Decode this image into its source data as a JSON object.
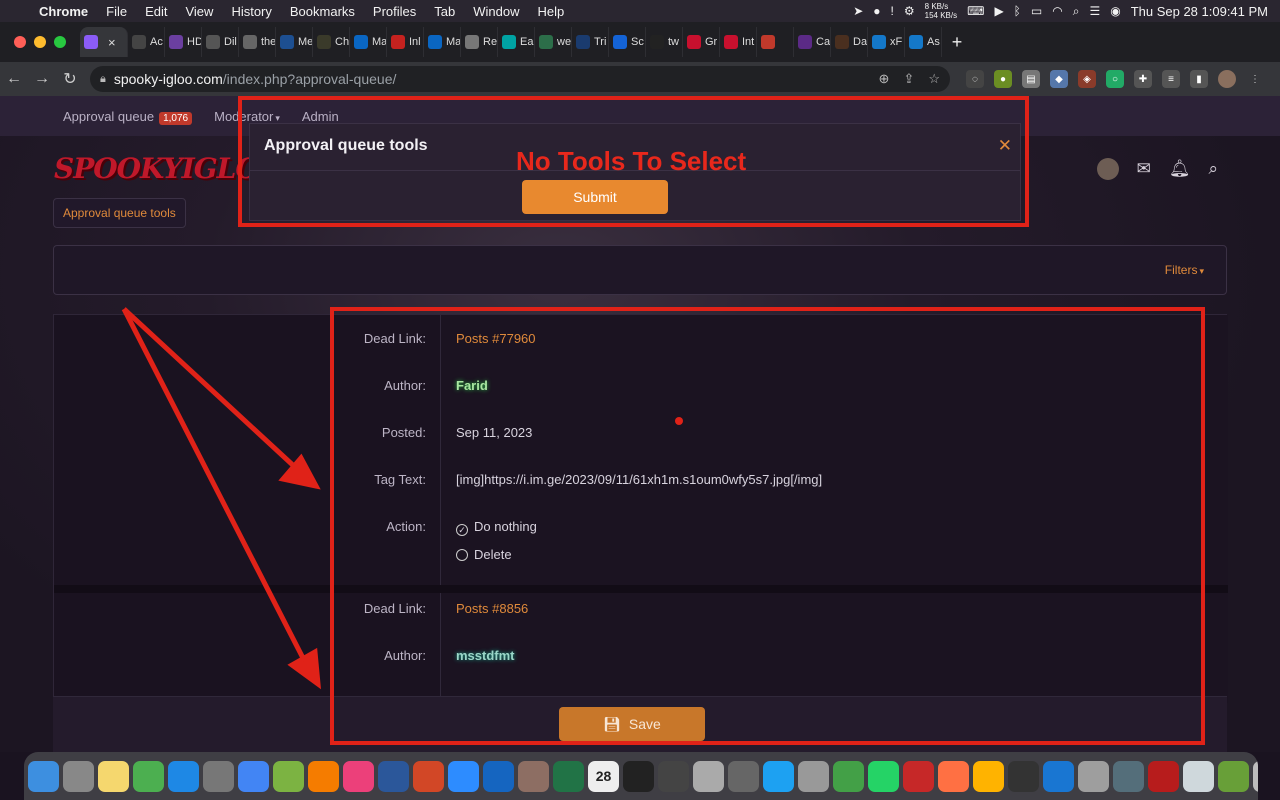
{
  "menubar": {
    "items": [
      "Chrome",
      "File",
      "Edit",
      "View",
      "History",
      "Bookmarks",
      "Profiles",
      "Tab",
      "Window",
      "Help"
    ],
    "net_up": "8 KB/s",
    "net_down": "154 KB/s",
    "clock": "Thu Sep 28  1:09:41 PM"
  },
  "tabs": [
    {
      "label": "",
      "color": "#8b5cf6",
      "icon": "ghost-icon"
    },
    {
      "label": "Ac",
      "color": "#444",
      "icon": "site-icon"
    },
    {
      "label": "HD",
      "color": "#6b3fa0",
      "icon": "site-icon"
    },
    {
      "label": "Dil",
      "color": "#555",
      "icon": "site-icon"
    },
    {
      "label": "the",
      "color": "#666",
      "icon": "globe-icon"
    },
    {
      "label": "Me",
      "color": "#1d4f91",
      "icon": "site-icon"
    },
    {
      "label": "Ch",
      "color": "#3a3a2a",
      "icon": "site-icon"
    },
    {
      "label": "Ma",
      "color": "#0a66c2",
      "icon": "outlook-icon"
    },
    {
      "label": "Inl",
      "color": "#c5221f",
      "icon": "gmail-icon"
    },
    {
      "label": "Ma",
      "color": "#0a66c2",
      "icon": "outlook-icon"
    },
    {
      "label": "Re",
      "color": "#777",
      "icon": "site-icon"
    },
    {
      "label": "Ea",
      "color": "#00a3a3",
      "icon": "site-icon"
    },
    {
      "label": "we",
      "color": "#2c6e49",
      "icon": "site-icon"
    },
    {
      "label": "Tri",
      "color": "#1a3b6e",
      "icon": "site-icon"
    },
    {
      "label": "Sc",
      "color": "#1463d6",
      "icon": "site-icon"
    },
    {
      "label": "tw",
      "color": "#222",
      "icon": "x-icon"
    },
    {
      "label": "Gr",
      "color": "#c8102e",
      "icon": "maple-icon"
    },
    {
      "label": "Int",
      "color": "#c8102e",
      "icon": "maple-icon"
    },
    {
      "label": "",
      "color": "#c0392b",
      "icon": "youtube-icon"
    },
    {
      "label": "Ca",
      "color": "#5b2a86",
      "icon": "site-icon"
    },
    {
      "label": "Da",
      "color": "#4a2f1f",
      "icon": "site-icon"
    },
    {
      "label": "xF",
      "color": "#1478c9",
      "icon": "xf-icon"
    },
    {
      "label": "As",
      "color": "#1478c9",
      "icon": "xf-icon"
    }
  ],
  "address": {
    "host": "spooky-igloo.com",
    "path": "/index.php?approval-queue/"
  },
  "staffbar": {
    "approval_label": "Approval queue",
    "approval_count": "1,076",
    "moderator_label": "Moderator",
    "admin_label": "Admin"
  },
  "logo_text": "SPOOKYIGLOO",
  "crumb_tab": "Approval queue tools",
  "filters_label": "Filters",
  "entries": [
    {
      "dead_link_label": "Dead Link:",
      "dead_link_value": "Posts #77960",
      "author_label": "Author:",
      "author_value": "Farid",
      "posted_label": "Posted:",
      "posted_value": "Sep 11, 2023",
      "tag_label": "Tag Text:",
      "tag_value": "[img]https://i.im.ge/2023/09/11/61xh1m.s1oum0wfy5s7.jpg[/img]",
      "action_label": "Action:",
      "action_options": [
        "Do nothing",
        "Delete"
      ],
      "selected_action": "Do nothing"
    },
    {
      "dead_link_label": "Dead Link:",
      "dead_link_value": "Posts #8856",
      "author_label": "Author:",
      "author_value": "msstdfmt"
    }
  ],
  "save_label": "Save",
  "dialog": {
    "title": "Approval queue tools",
    "submit_label": "Submit"
  },
  "annotation_text": "No Tools To Select",
  "annotation_color": "#e02218",
  "dock_apps": [
    "finder-icon",
    "launchpad-icon",
    "notes-icon",
    "maps-icon",
    "appstore-icon",
    "settings-icon",
    "chrome-icon",
    "norton-icon",
    "vlc-icon",
    "photos-icon",
    "word-icon",
    "powerpoint-icon",
    "zoom-icon",
    "iptv-icon",
    "tool-icon",
    "excel-icon",
    "calendar-icon",
    "terminal-icon",
    "imovie-icon",
    "preview-icon",
    "calculator-icon",
    "twitter-icon",
    "screenshot-icon",
    "messages-icon",
    "whatsapp-icon",
    "antivirus-icon",
    "fruit-icon",
    "vlc2-icon",
    "obd-icon",
    "screen-icon",
    "scanner-icon",
    "quicktime-icon",
    "filezilla-icon",
    "mail-icon",
    "norton2-icon",
    "trash-icon"
  ],
  "calendar_day": "28"
}
